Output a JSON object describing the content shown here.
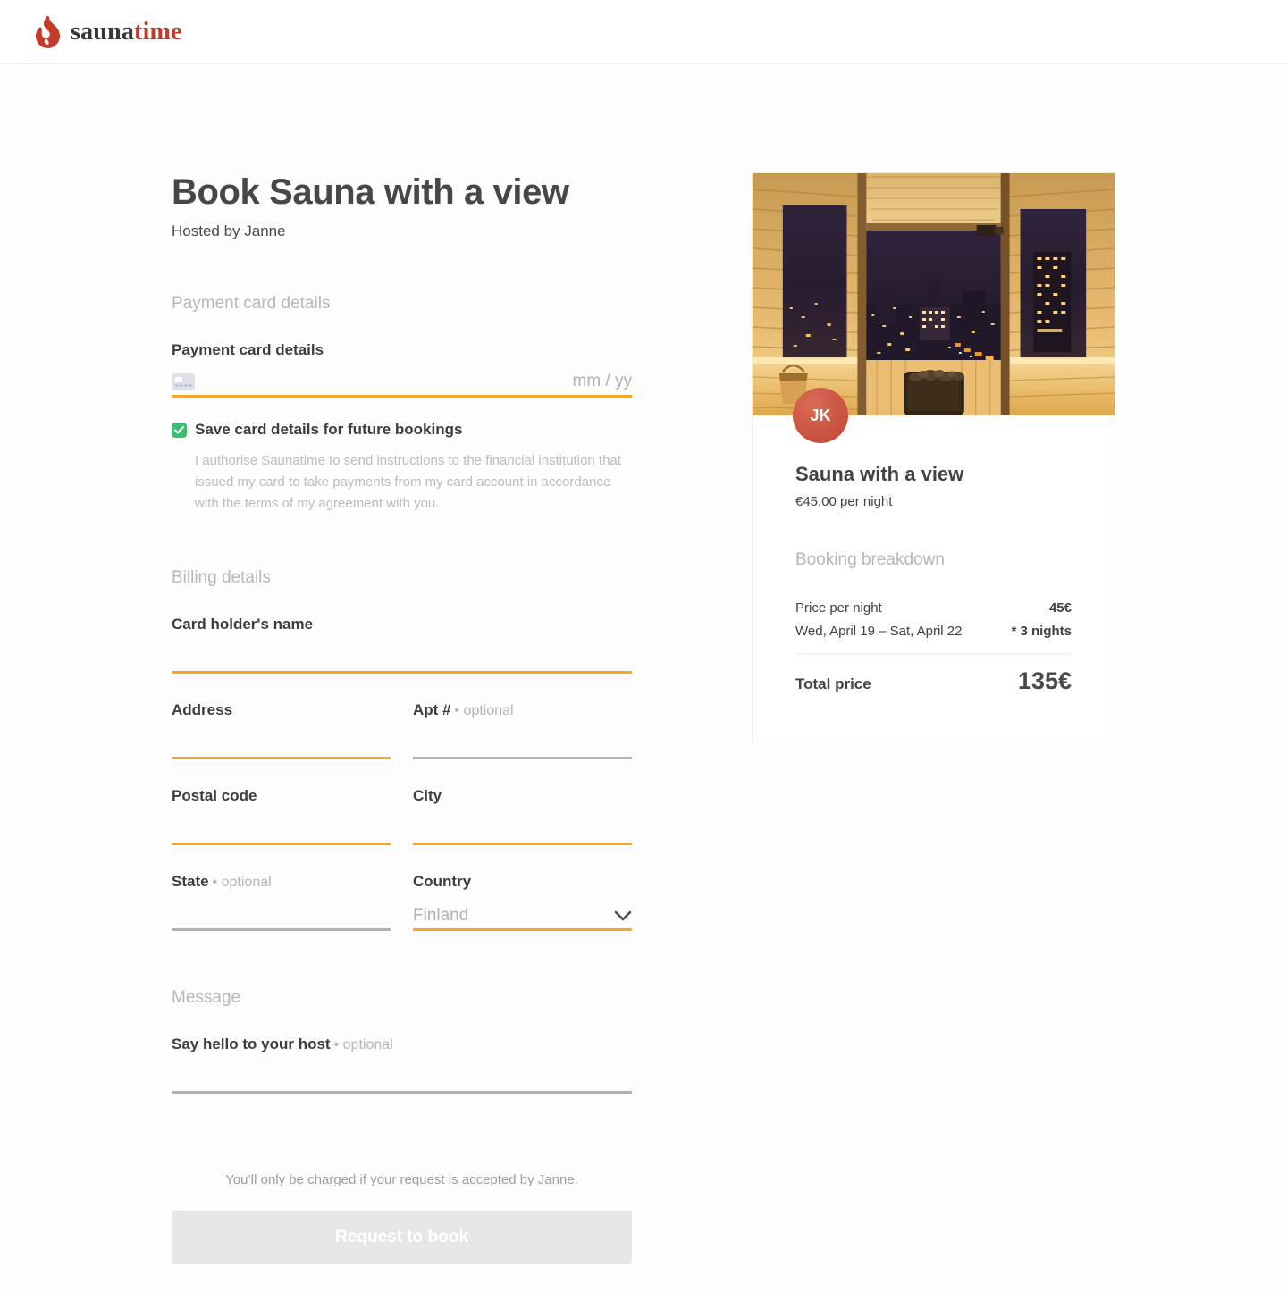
{
  "header": {
    "logo_primary": "sauna",
    "logo_accent": "time"
  },
  "page": {
    "title": "Book Sauna with a view",
    "subtitle": "Hosted by Janne"
  },
  "payment": {
    "heading": "Payment card details",
    "card_label": "Payment card details",
    "card_number_value": "",
    "expiry_placeholder": "mm / yy",
    "save_card_label": "Save card details for future bookings",
    "save_card_checked": true,
    "authorise_text": "I authorise Saunatime to send instructions to the financial institution that issued my card to take payments from my card account in accordance with the terms of my agreement with you."
  },
  "billing": {
    "heading": "Billing details",
    "card_holder_label": "Card holder's name",
    "address_label": "Address",
    "apt_label": "Apt #",
    "apt_optional": "• optional",
    "postal_label": "Postal code",
    "city_label": "City",
    "state_label": "State",
    "state_optional": "• optional",
    "country_label": "Country",
    "country_value": "Finland"
  },
  "message": {
    "heading": "Message",
    "label": "Say hello to your host",
    "optional": "• optional"
  },
  "footer": {
    "charge_note": "You’ll only be charged if your request is accepted by Janne.",
    "button_label": "Request to book"
  },
  "booking_card": {
    "avatar_initials": "JK",
    "title": "Sauna with a view",
    "price_per_night": "€45.00 per night",
    "breakdown_heading": "Booking breakdown",
    "price_label": "Price per night",
    "price_value": "45€",
    "dates_label": "Wed, April 19 – Sat, April 22",
    "nights_value": "* 3 nights",
    "total_label": "Total price",
    "total_value": "135€"
  },
  "icons": {
    "logo": "flame-icon",
    "card_field": "credit-card-icon",
    "save_card": "checkmark-icon",
    "country_select": "chevron-down-icon"
  },
  "colors": {
    "accent_underline": "#f5a623",
    "optional_underline": "#b0b0b0",
    "brand_red": "#c23b2b",
    "checkbox_green": "#3dbd72",
    "avatar_red": "#cc5544",
    "disabled_button_bg": "#e6e6e6"
  }
}
